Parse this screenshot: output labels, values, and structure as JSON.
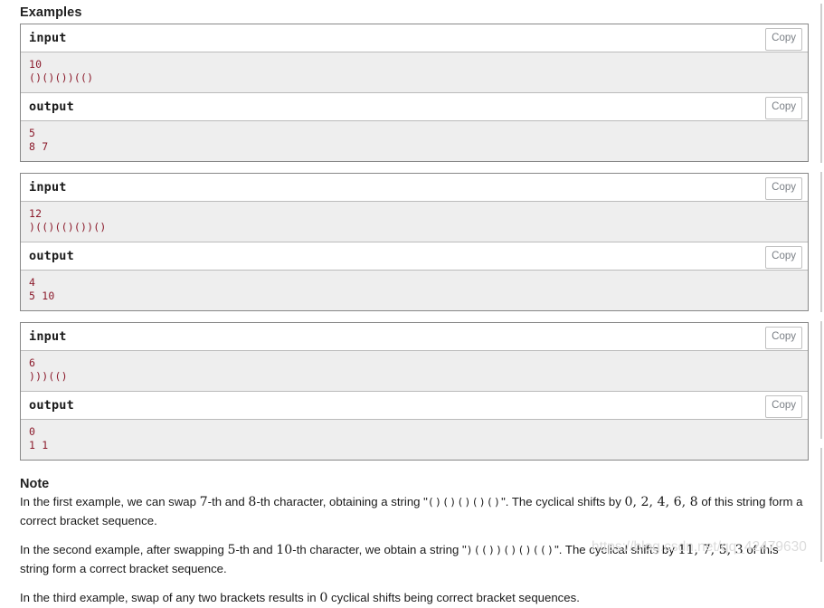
{
  "examples": {
    "heading": "Examples",
    "copy_label": "Copy",
    "blocks": [
      {
        "input_label": "input",
        "input_text": "10\n()()())(()",
        "output_label": "output",
        "output_text": "5\n8 7"
      },
      {
        "input_label": "input",
        "input_text": "12\n)(()(()())()",
        "output_label": "output",
        "output_text": "4\n5 10"
      },
      {
        "input_label": "input",
        "input_text": "6\n)))(()",
        "output_label": "output",
        "output_text": "0\n1 1"
      }
    ]
  },
  "note": {
    "heading": "Note",
    "paragraphs": [
      {
        "t1": "In the first example, we can swap ",
        "n1": "7",
        "t2": "-th and ",
        "n2": "8",
        "t3": "-th character, obtaining a string \"",
        "brackets": "()()()()()",
        "t4": "\". The cyclical shifts by ",
        "n3": "0, 2, 4, 6, 8",
        "t5": " of this string form a correct bracket sequence."
      },
      {
        "t1": "In the second example, after swapping ",
        "n1": "5",
        "t2": "-th and ",
        "n2": "10",
        "t3": "-th character, we obtain a string \"",
        "brackets": ")(())()()(()",
        "t4": "\". The cyclical shifts by ",
        "n3": "11, 7, 5, 3",
        "t5": " of this string form a correct bracket sequence."
      },
      {
        "t1": "In the third example, swap of any two brackets results in ",
        "n1": "0",
        "t2": " cyclical shifts being correct bracket sequences.",
        "n2": "",
        "t3": "",
        "brackets": "",
        "t4": "",
        "n3": "",
        "t5": ""
      }
    ]
  },
  "watermark": {
    "text": "https://blog.csdn.net/qq_42479630"
  },
  "colors": {
    "io_text": "#8b1a2b",
    "io_bg": "#eeeeee",
    "border": "#888888",
    "copy_text": "#7a7f85",
    "watermark": "#dcdcdc"
  }
}
